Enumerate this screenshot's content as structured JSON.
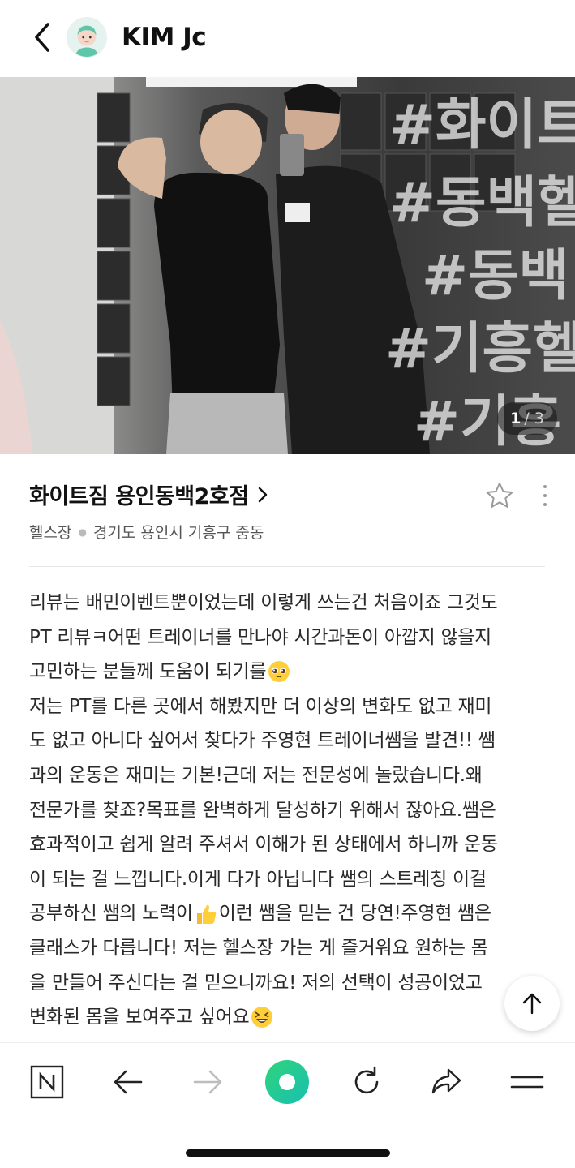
{
  "header": {
    "username": "KIM Jc"
  },
  "photo": {
    "counter_current": "1",
    "counter_total": "/ 3",
    "overlay_tags": [
      "#화이트",
      "#동백헬",
      "#동백",
      "#기흥헬",
      "#기흥"
    ]
  },
  "place": {
    "name": "화이트짐 용인동백2호점",
    "category": "헬스장",
    "address": "경기도 용인시 기흥구 중동"
  },
  "review": {
    "lines": [
      "리뷰는 배민이벤트뿐이었는데 이렇게 쓰는건 처음이죠 그것도",
      "PT 리뷰ㅋ어떤 트레이너를 만나야 시간과돈이 아깝지 않을지",
      "고민하는 분들께 도움이 되기를",
      "저는 PT를 다른 곳에서 해봤지만 더 이상의 변화도 없고 재미",
      "도 없고 아니다 싶어서 찾다가 주영현 트레이너쌤을 발견!! 쌤",
      "과의 운동은 재미는 기본!근데 저는 전문성에 놀랐습니다.왜",
      "전문가를 찾죠?목표를 완벽하게 달성하기 위해서 잖아요.쌤은",
      "효과적이고 쉽게 알려 주셔서 이해가 된 상태에서 하니까 운동",
      "이 되는 걸 느낍니다.이게 다가 아닙니다 쌤의 스트레칭 이걸",
      "공부하신 쌤의 노력이",
      "이런 쌤을 믿는 건 당연!주영현 쌤은",
      "클래스가 다릅니다! 저는 헬스장 가는 게 즐거워요 원하는 몸",
      "을 만들어 주신다는 걸 믿으니까요! 저의 선택이 성공이었고",
      "변화된 몸을 보여주고 싶어요"
    ]
  },
  "colors": {
    "accent_green": "#2ed47a",
    "text_primary": "#111111",
    "text_secondary": "#555555"
  },
  "icons": {
    "back": "chevron-left-icon",
    "star": "star-outline-icon",
    "more": "more-vertical-icon",
    "scroll_top": "arrow-up-icon",
    "nav": [
      "naver-n-icon",
      "back-arrow-icon",
      "forward-arrow-icon",
      "green-home-icon",
      "refresh-icon",
      "share-icon",
      "menu-icon"
    ]
  }
}
